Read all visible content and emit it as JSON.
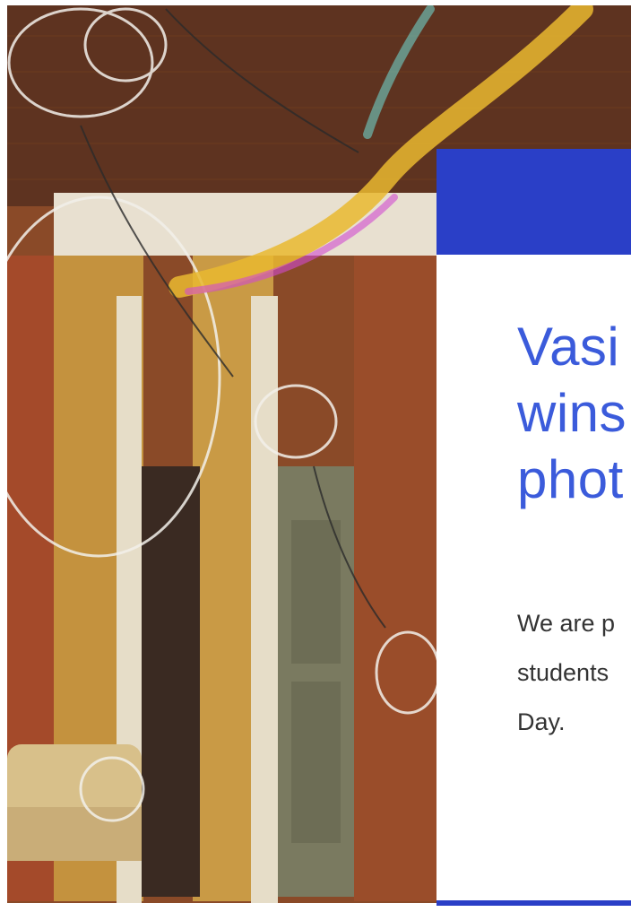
{
  "article": {
    "headline": "Vasi wins phot",
    "headline_lines": [
      "Vasi",
      "wins",
      "phot"
    ],
    "excerpt_lines": [
      "We are p",
      "students",
      "Day."
    ]
  },
  "hero_image": {
    "description_icon": "photo-soap-bubbles"
  },
  "colors": {
    "headline": "#3b5bdb",
    "accent_blue": "#2a3fc7",
    "body_text": "#333333"
  }
}
